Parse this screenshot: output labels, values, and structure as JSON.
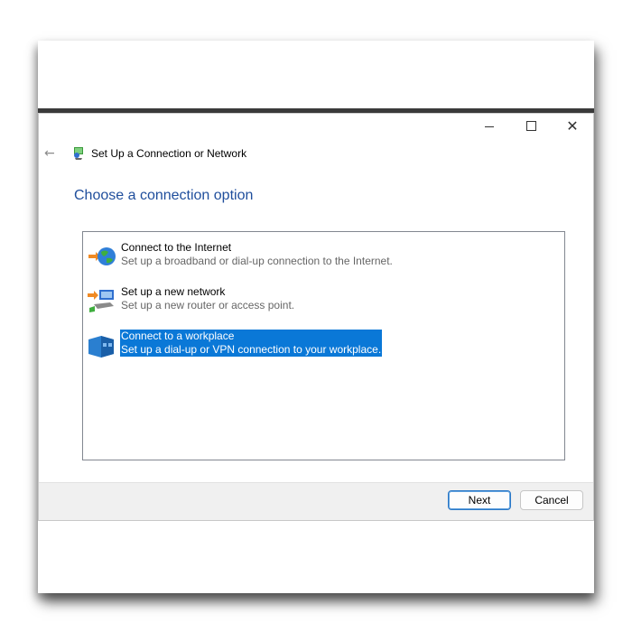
{
  "window": {
    "title": "Set Up a Connection or Network",
    "controls": {
      "minimize": "minimize",
      "maximize": "maximize",
      "close": "✕"
    }
  },
  "nav": {
    "back_glyph": "←"
  },
  "heading": "Choose a connection option",
  "options": [
    {
      "title": "Connect to the Internet",
      "description": "Set up a broadband or dial-up connection to the Internet.",
      "icon": "globe-internet-icon"
    },
    {
      "title": "Set up a new network",
      "description": "Set up a new router or access point.",
      "icon": "network-router-icon"
    },
    {
      "title": "Connect to a workplace",
      "description": "Set up a dial-up or VPN connection to your workplace.",
      "icon": "workplace-vpn-icon",
      "selected": true
    }
  ],
  "buttons": {
    "next": "Next",
    "cancel": "Cancel"
  },
  "colors": {
    "heading": "#1f4e9c",
    "selection": "#0a78d7",
    "footer": "#f0f0f0"
  }
}
